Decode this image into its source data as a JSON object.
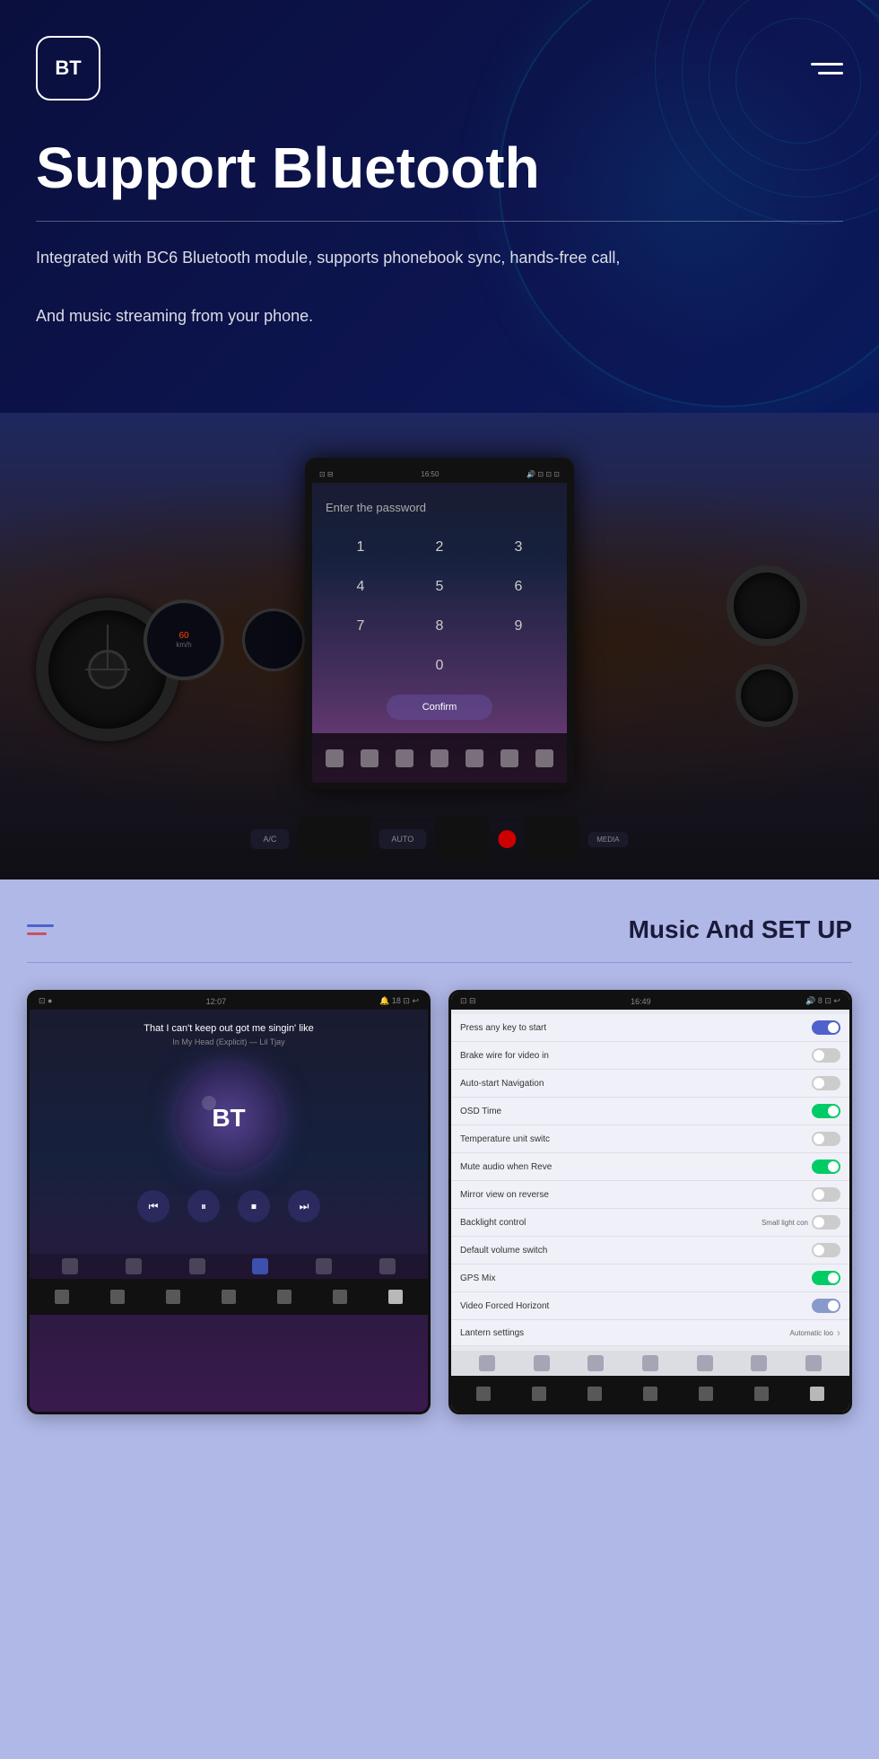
{
  "nav": {
    "logo_text": "BT",
    "menu_label": "Menu"
  },
  "header": {
    "title": "Support Bluetooth",
    "description_line1": "Integrated with BC6 Bluetooth module, supports phonebook sync, hands-free call,",
    "description_line2": "And music streaming from your phone."
  },
  "screen": {
    "time": "16:50",
    "password_label": "Enter the password",
    "numpad": [
      "1",
      "2",
      "3",
      "4",
      "5",
      "6",
      "7",
      "8",
      "9",
      "0"
    ],
    "confirm_btn": "Confirm"
  },
  "bottom_panel": {
    "title": "Music And SET UP",
    "menu_label": "Panel menu"
  },
  "music_screen": {
    "status_time": "12:07",
    "status_icons": "18",
    "song_title": "That I can't keep out got me singin' like",
    "song_subtitle": "In My Head (Explicit) — Lil Tjay",
    "bt_label": "BT"
  },
  "settings_screen": {
    "status_time": "16:49",
    "status_icons": "8",
    "items": [
      {
        "label": "Press any key to start",
        "toggle": "on",
        "extra": ""
      },
      {
        "label": "Brake wire for video in",
        "toggle": "off",
        "extra": ""
      },
      {
        "label": "Auto-start Navigation",
        "toggle": "off",
        "extra": ""
      },
      {
        "label": "OSD Time",
        "toggle": "green",
        "extra": ""
      },
      {
        "label": "Temperature unit switc",
        "toggle": "off",
        "extra": ""
      },
      {
        "label": "Mute audio when Reve",
        "toggle": "green",
        "extra": ""
      },
      {
        "label": "Mirror view on reverse",
        "toggle": "off",
        "extra": ""
      },
      {
        "label": "Backlight control",
        "toggle": "off",
        "extra": "Small light con"
      },
      {
        "label": "Default volume switch",
        "toggle": "off",
        "extra": ""
      },
      {
        "label": "GPS Mix",
        "toggle": "green",
        "extra": ""
      },
      {
        "label": "Video Forced Horizont",
        "toggle": "on",
        "extra": ""
      },
      {
        "label": "Lantern settings",
        "toggle": "chevron",
        "extra": "Automatic loo"
      }
    ]
  }
}
